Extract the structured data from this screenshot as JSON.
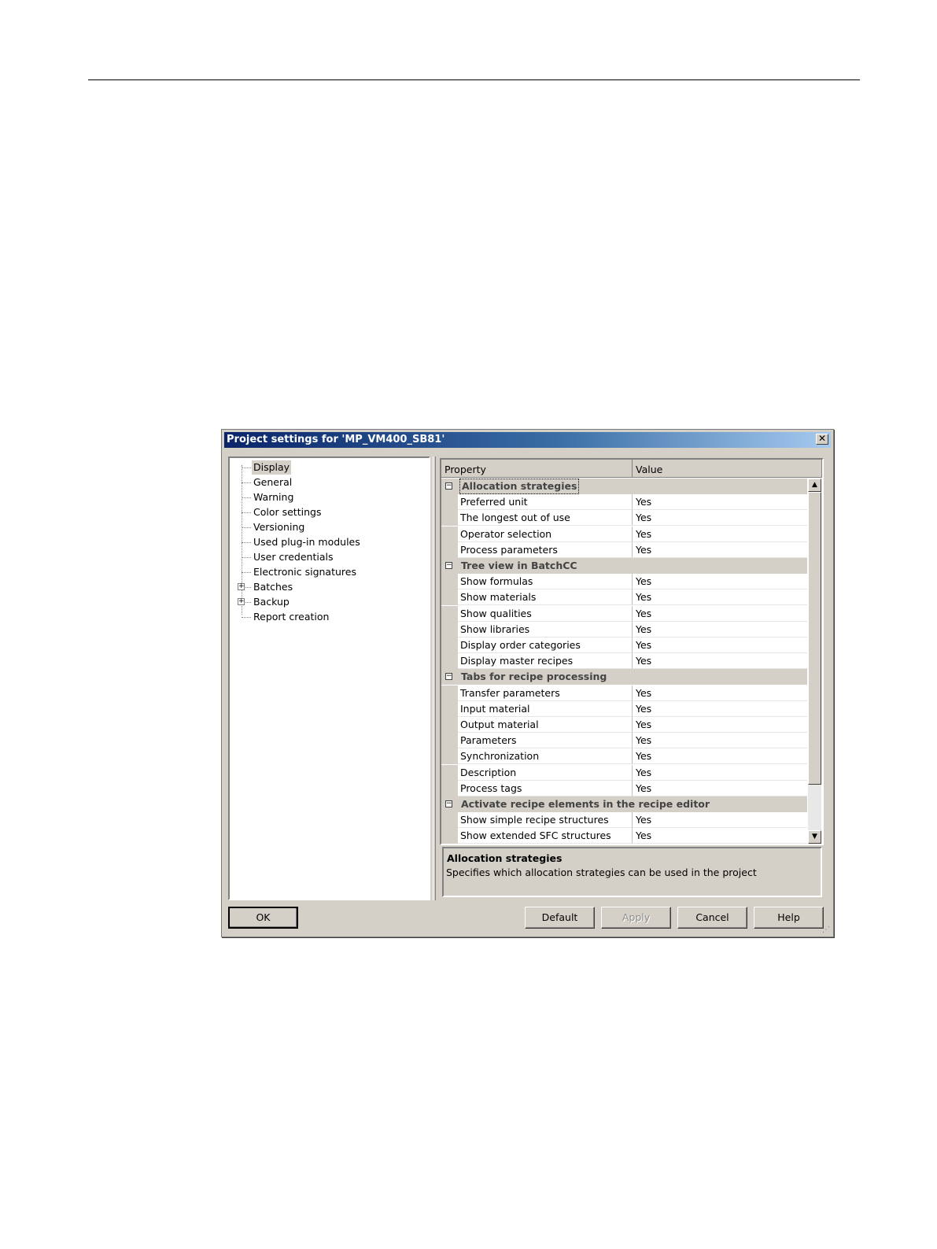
{
  "dialog": {
    "title": "Project settings for 'MP_VM400_SB81'",
    "close_glyph": "✕"
  },
  "tree": {
    "items": [
      {
        "label": "Display",
        "expandable": false,
        "selected": true
      },
      {
        "label": "General",
        "expandable": false
      },
      {
        "label": "Warning",
        "expandable": false
      },
      {
        "label": "Color settings",
        "expandable": false
      },
      {
        "label": "Versioning",
        "expandable": false
      },
      {
        "label": "Used plug-in modules",
        "expandable": false
      },
      {
        "label": "User credentials",
        "expandable": false
      },
      {
        "label": "Electronic signatures",
        "expandable": false
      },
      {
        "label": "Batches",
        "expandable": true
      },
      {
        "label": "Backup",
        "expandable": true
      },
      {
        "label": "Report creation",
        "expandable": false
      }
    ],
    "expander_glyph": "+"
  },
  "grid": {
    "headers": {
      "property": "Property",
      "value": "Value"
    },
    "collapse_glyph": "−",
    "categories": [
      {
        "label": "Allocation strategies",
        "focused": true,
        "rows": [
          {
            "property": "Preferred unit",
            "value": "Yes"
          },
          {
            "property": "The longest out of use",
            "value": "Yes"
          },
          {
            "property": "Operator selection",
            "value": "Yes"
          },
          {
            "property": "Process parameters",
            "value": "Yes"
          }
        ]
      },
      {
        "label": "Tree view in BatchCC",
        "rows": [
          {
            "property": "Show formulas",
            "value": "Yes"
          },
          {
            "property": "Show materials",
            "value": "Yes"
          },
          {
            "property": "Show qualities",
            "value": "Yes"
          },
          {
            "property": "Show libraries",
            "value": "Yes"
          },
          {
            "property": "Display order categories",
            "value": "Yes"
          },
          {
            "property": "Display master recipes",
            "value": "Yes"
          }
        ]
      },
      {
        "label": "Tabs for recipe processing",
        "rows": [
          {
            "property": "Transfer parameters",
            "value": "Yes"
          },
          {
            "property": "Input material",
            "value": "Yes"
          },
          {
            "property": "Output material",
            "value": "Yes"
          },
          {
            "property": "Parameters",
            "value": "Yes"
          },
          {
            "property": "Synchronization",
            "value": "Yes"
          },
          {
            "property": "Description",
            "value": "Yes"
          },
          {
            "property": "Process tags",
            "value": "Yes"
          }
        ]
      },
      {
        "label": "Activate recipe elements in the recipe editor",
        "rows": [
          {
            "property": "Show simple recipe structures",
            "value": "Yes"
          },
          {
            "property": "Show extended SFC structures",
            "value": "Yes"
          }
        ]
      }
    ],
    "scroll_up_glyph": "▲",
    "scroll_down_glyph": "▼"
  },
  "description": {
    "title": "Allocation strategies",
    "text": "Specifies which allocation strategies can be used in the project"
  },
  "buttons": {
    "ok": "OK",
    "default": "Default",
    "apply": "Apply",
    "cancel": "Cancel",
    "help": "Help"
  },
  "grip_glyph": "⋰"
}
